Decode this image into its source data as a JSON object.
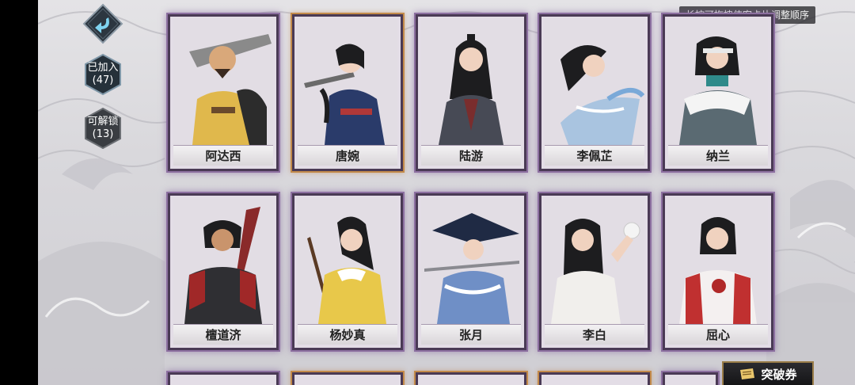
{
  "hint_text": "长按可拖拽侠客卡片调整顺序",
  "side": {
    "joined_label": "已加入",
    "joined_count": "(47)",
    "unlockable_label": "可解锁",
    "unlockable_count": "(13)"
  },
  "cards": [
    {
      "name": "阿达西"
    },
    {
      "name": "唐婉"
    },
    {
      "name": "陆游"
    },
    {
      "name": "李佩芷"
    },
    {
      "name": "纳兰"
    },
    {
      "name": "檀道济"
    },
    {
      "name": "杨妙真"
    },
    {
      "name": "张月"
    },
    {
      "name": "李白"
    },
    {
      "name": "屈心"
    }
  ],
  "ticket_button_label": "突破券",
  "colors": {
    "card_frame_purple": "#8c6fa0",
    "card_frame_orange": "#c38a4a",
    "badge_bg": "#2f3a45"
  }
}
